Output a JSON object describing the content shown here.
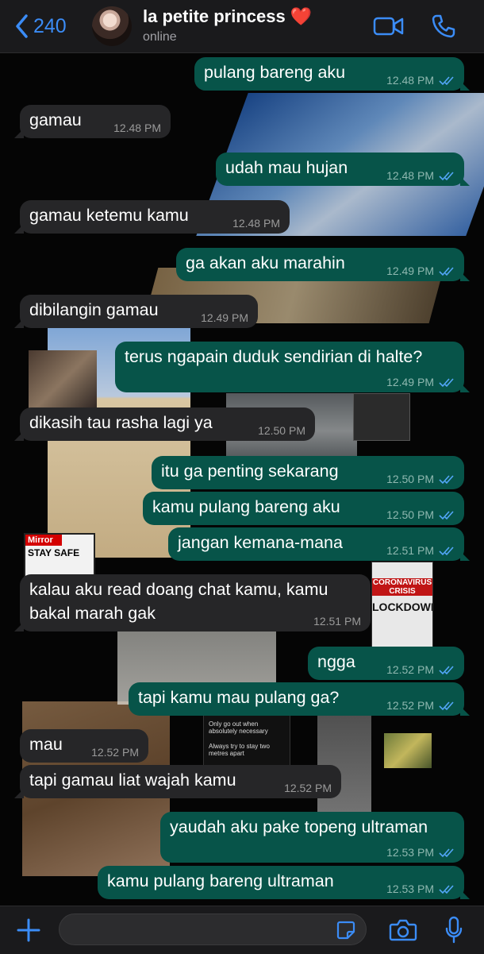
{
  "header": {
    "back_count": "240",
    "contact_name": "la petite princess",
    "heart": "❤️",
    "status": "online"
  },
  "icons": {
    "back": "chevron-left-icon",
    "video": "video-camera-icon",
    "call": "phone-icon",
    "attach": "plus-icon",
    "sticker": "sticker-icon",
    "camera": "camera-icon",
    "mic": "microphone-icon"
  },
  "colors": {
    "accent": "#3b8cf6",
    "outgoing_bubble": "#075449",
    "incoming_bubble": "#262628",
    "read_ticks": "#53a6f8"
  },
  "messages": [
    {
      "dir": "out",
      "text": "pulang bareng aku",
      "time": "12.48 PM"
    },
    {
      "dir": "in",
      "text": "gamau",
      "time": "12.48 PM"
    },
    {
      "dir": "out",
      "text": "udah mau hujan",
      "time": "12.48 PM"
    },
    {
      "dir": "in",
      "text": "gamau ketemu kamu",
      "time": "12.48 PM"
    },
    {
      "dir": "out",
      "text": "ga akan aku marahin",
      "time": "12.49 PM"
    },
    {
      "dir": "in",
      "text": "dibilangin gamau",
      "time": "12.49 PM"
    },
    {
      "dir": "out",
      "text": "terus ngapain duduk sendirian di halte?",
      "time": "12.49 PM"
    },
    {
      "dir": "in",
      "text": "dikasih tau rasha lagi ya",
      "time": "12.50 PM"
    },
    {
      "dir": "out",
      "text": "itu ga penting sekarang",
      "time": "12.50 PM"
    },
    {
      "dir": "out",
      "text": "kamu pulang bareng aku",
      "time": "12.50 PM"
    },
    {
      "dir": "out",
      "text": "jangan kemana-mana",
      "time": "12.51 PM"
    },
    {
      "dir": "in",
      "text": "kalau aku read doang chat kamu, kamu bakal marah gak",
      "time": "12.51 PM"
    },
    {
      "dir": "out",
      "text": "ngga",
      "time": "12.52 PM"
    },
    {
      "dir": "out",
      "text": "tapi kamu mau pulang ga?",
      "time": "12.52 PM"
    },
    {
      "dir": "in",
      "text": "mau",
      "time": "12.52 PM"
    },
    {
      "dir": "in",
      "text": "tapi gamau liat wajah kamu",
      "time": "12.52 PM"
    },
    {
      "dir": "out",
      "text": "yaudah aku pake topeng ultraman",
      "time": "12.53 PM"
    },
    {
      "dir": "out",
      "text": "kamu pulang bareng ultraman",
      "time": "12.53 PM"
    }
  ],
  "wallpaper": {
    "newspaper_1": "Mirror",
    "newspaper_1_headline": "STAY SAFE",
    "newspaper_2_line1": "CORONAVIRUS",
    "newspaper_2_line2": "CRISIS",
    "newspaper_2_line3": "LOCKDOWN",
    "screen_text_1": "Only go out when absolutely necessary",
    "screen_text_2": "Always try to stay two metres apart"
  }
}
